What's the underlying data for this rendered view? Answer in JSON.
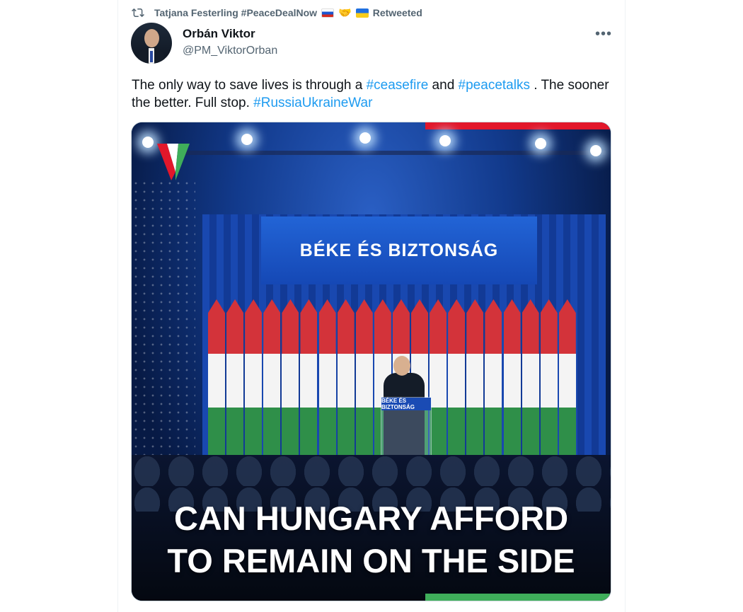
{
  "retweet": {
    "user": "Tatjana Festerling #PeaceDealNow",
    "emoji": "🤝",
    "label": "Retweeted"
  },
  "author": {
    "name": "Orbán Viktor",
    "handle": "@PM_ViktorOrban"
  },
  "tweet": {
    "text_1": "The only way to save lives is through a ",
    "tag_1": "#ceasefire",
    "text_2": " and ",
    "tag_2": "#peacetalks",
    "text_3": " . The sooner the better. Full stop. ",
    "tag_3": "#RussiaUkraineWar"
  },
  "media": {
    "banner": "BÉKE ÉS BIZTONSÁG",
    "podium_label": "BÉKE ÉS BIZTONSÁG",
    "caption_line_1": "CAN HUNGARY AFFORD",
    "caption_line_2": "TO REMAIN ON THE SIDE"
  },
  "icons": {
    "more": "more-options-icon",
    "retweet": "retweet-icon"
  },
  "colors": {
    "link": "#1d9bf0",
    "secondary_text": "#536471",
    "primary_text": "#0f1419"
  }
}
